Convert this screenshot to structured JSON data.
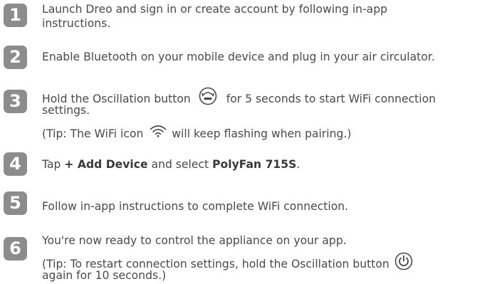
{
  "steps": [
    {
      "number": "1",
      "lines": [
        "Launch Dreo and sign in or create account by following in-app",
        "instructions."
      ]
    },
    {
      "number": "2",
      "lines": [
        "Enable Bluetooth on your mobile device and plug in your air circulator."
      ]
    },
    {
      "number": "3",
      "line1_before": "Hold the Oscillation button",
      "line1_after": "for 5 seconds to start WiFi connection",
      "line2": "settings.",
      "tip_before": "(Tip: The WiFi icon",
      "tip_after": "will keep flashing when pairing.)",
      "oscillation_icon": "oscillation-icon",
      "wifi_icon": "wifi-icon"
    },
    {
      "number": "4",
      "text_tap": "Tap",
      "text_add": "+ Add Device",
      "text_and": "and select",
      "text_model": "PolyFan 715S",
      "text_end": "."
    },
    {
      "number": "5",
      "lines": [
        "Follow in-app instructions to complete WiFi connection."
      ]
    },
    {
      "number": "6",
      "line1": "You're now ready to control the appliance on your app.",
      "tip_line1": "(Tip: To restart connection settings, hold the Oscillation button",
      "tip_line2": "again for 10 seconds.)",
      "power_icon": "power-icon"
    }
  ],
  "colors": {
    "badge": "#8c8c8c",
    "text": "#4a4a4a"
  }
}
